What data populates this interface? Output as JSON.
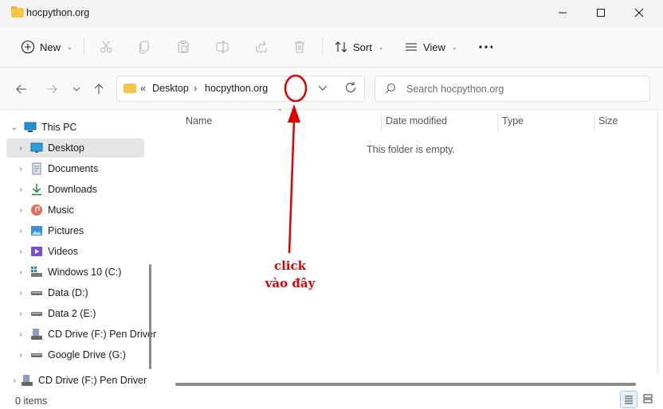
{
  "window": {
    "title": "hocpython.org"
  },
  "toolbar": {
    "new_label": "New",
    "sort_label": "Sort",
    "view_label": "View"
  },
  "address": {
    "overflow": "«",
    "crumb_1": "Desktop",
    "separator": "›",
    "crumb_2": "hocpython.org"
  },
  "search": {
    "placeholder": "Search hocpython.org"
  },
  "sidebar": {
    "root": "This PC",
    "items": [
      {
        "label": "Desktop",
        "icon": "desktop-icon"
      },
      {
        "label": "Documents",
        "icon": "documents-icon"
      },
      {
        "label": "Downloads",
        "icon": "downloads-icon"
      },
      {
        "label": "Music",
        "icon": "music-icon"
      },
      {
        "label": "Pictures",
        "icon": "pictures-icon"
      },
      {
        "label": "Videos",
        "icon": "videos-icon"
      },
      {
        "label": "Windows 10 (C:)",
        "icon": "windows-drive-icon"
      },
      {
        "label": "Data (D:)",
        "icon": "drive-icon"
      },
      {
        "label": "Data 2 (E:)",
        "icon": "drive-icon"
      },
      {
        "label": "CD Drive (F:) Pen Driver",
        "icon": "cd-drive-icon"
      },
      {
        "label": "Google Drive (G:)",
        "icon": "drive-icon"
      }
    ],
    "bottom_item": "CD Drive (F:) Pen Driver"
  },
  "columns": {
    "name": "Name",
    "date": "Date modified",
    "type": "Type",
    "size": "Size"
  },
  "content": {
    "empty_message": "This folder is empty."
  },
  "status": {
    "items_count": "0 items"
  },
  "annotation": {
    "line1": "click",
    "line2": "vào đây",
    "color": "#e00000"
  },
  "colors": {
    "accent": "#0067c0",
    "selected_bg": "#e5e5e5",
    "folder": "#f2c744"
  }
}
